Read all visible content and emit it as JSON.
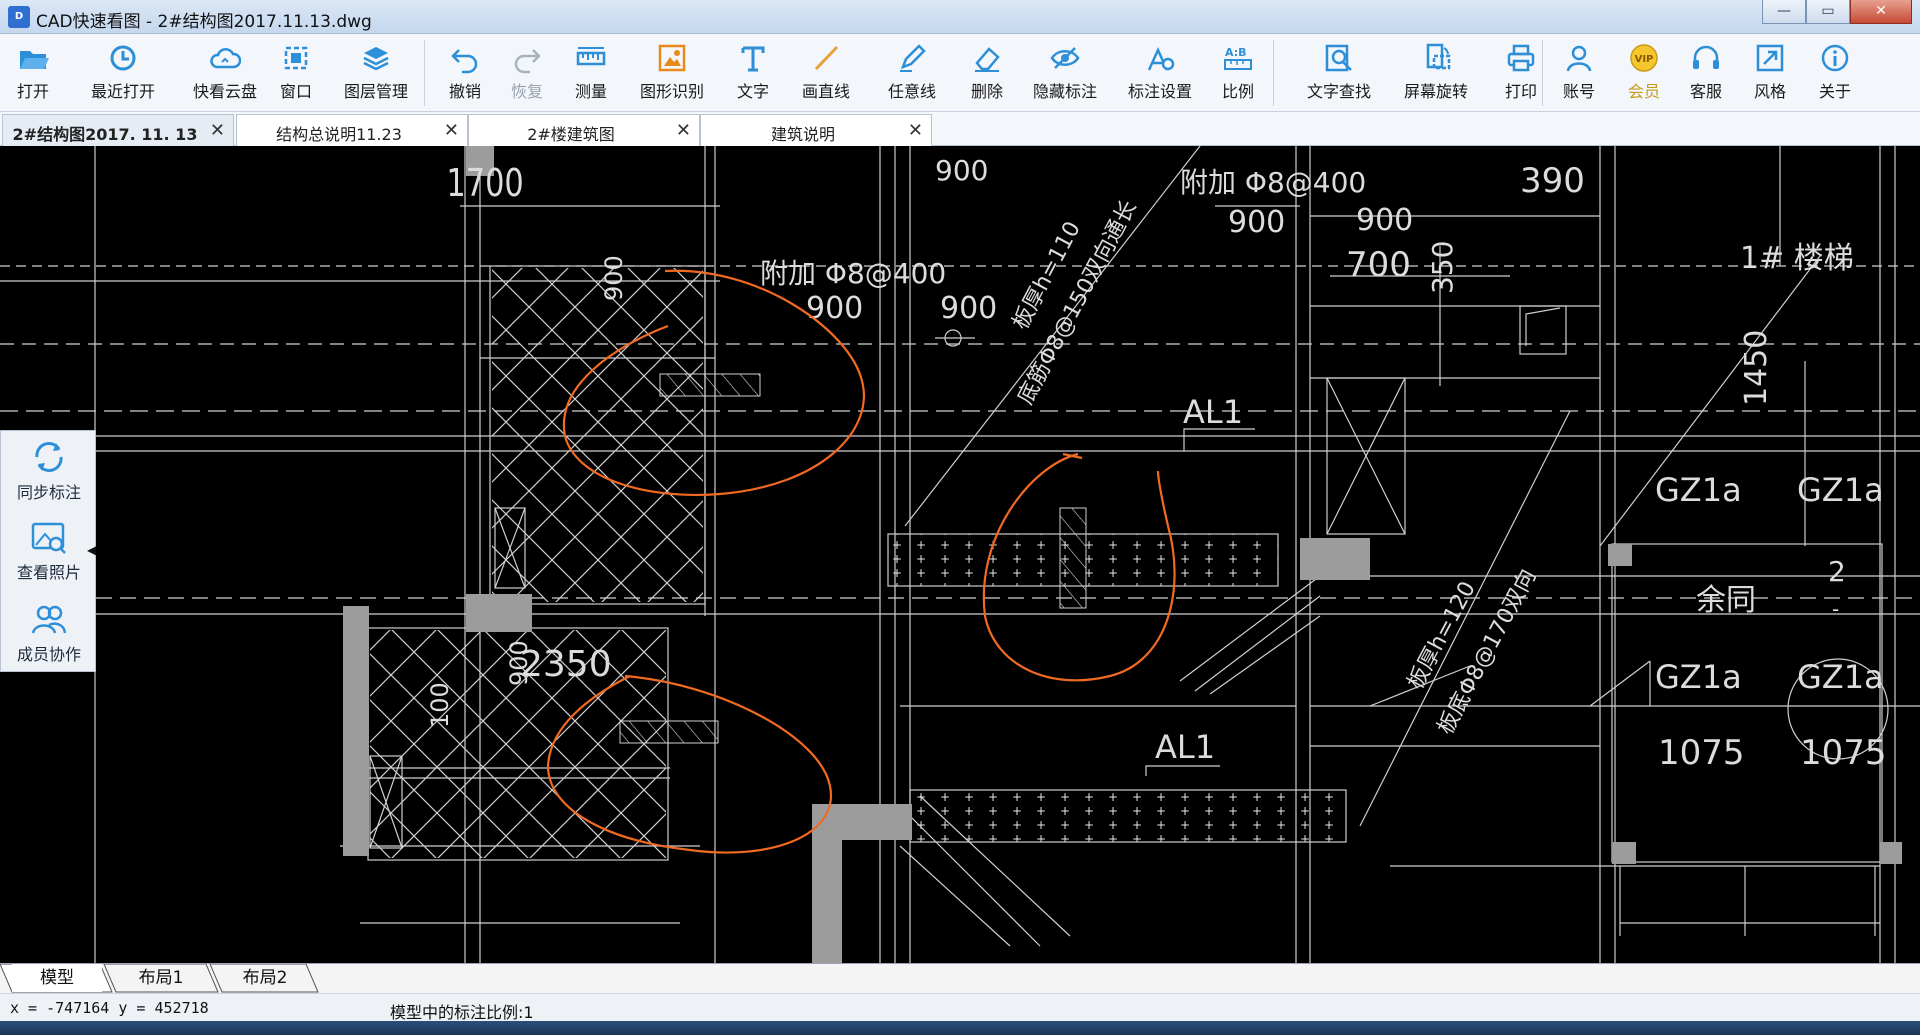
{
  "window": {
    "icon_text": "D",
    "title": "CAD快速看图 - 2#结构图2017.11.13.dwg",
    "title_faded": "",
    "controls": {
      "minimize": "—",
      "maximize": "▭",
      "close": "✕"
    }
  },
  "toolbar": {
    "items": [
      {
        "label": "打开",
        "icon": "folder-open-icon",
        "disabled": false
      },
      {
        "label": "最近打开",
        "icon": "recent-clock-icon",
        "disabled": false
      },
      {
        "label": "快看云盘",
        "icon": "cloud-icon",
        "disabled": false
      },
      {
        "label": "窗口",
        "icon": "window-icon",
        "disabled": false
      },
      {
        "label": "图层管理",
        "icon": "layers-icon",
        "disabled": false
      },
      {
        "label": "撤销",
        "icon": "undo-icon",
        "disabled": false
      },
      {
        "label": "恢复",
        "icon": "redo-icon",
        "disabled": true
      },
      {
        "label": "测量",
        "icon": "ruler-icon",
        "disabled": false
      },
      {
        "label": "图形识别",
        "icon": "shape-recognize-icon",
        "disabled": false
      },
      {
        "label": "文字",
        "icon": "text-icon",
        "disabled": false
      },
      {
        "label": "画直线",
        "icon": "line-icon",
        "disabled": false
      },
      {
        "label": "任意线",
        "icon": "pen-icon",
        "disabled": false
      },
      {
        "label": "删除",
        "icon": "eraser-icon",
        "disabled": false
      },
      {
        "label": "隐藏标注",
        "icon": "eye-hide-icon",
        "disabled": false
      },
      {
        "label": "标注设置",
        "icon": "annotation-settings-icon",
        "disabled": false
      },
      {
        "label": "比例",
        "icon": "scale-ratio-icon",
        "disabled": false
      },
      {
        "label": "文字查找",
        "icon": "text-search-icon",
        "disabled": false
      },
      {
        "label": "屏幕旋转",
        "icon": "rotate-screen-icon",
        "disabled": false
      },
      {
        "label": "打印",
        "icon": "printer-icon",
        "disabled": false
      },
      {
        "label": "账号",
        "icon": "user-icon",
        "disabled": false
      },
      {
        "label": "会员",
        "icon": "vip-icon",
        "disabled": false,
        "vip": true,
        "badge": "VIP"
      },
      {
        "label": "客服",
        "icon": "headset-icon",
        "disabled": false
      },
      {
        "label": "风格",
        "icon": "style-icon",
        "disabled": false
      },
      {
        "label": "关于",
        "icon": "info-icon",
        "disabled": false
      }
    ],
    "ratio_icon_text": "A:B"
  },
  "tabs": [
    {
      "label": "2#结构图2017. 11. 13",
      "active": true
    },
    {
      "label": "结构总说明11.23",
      "active": false
    },
    {
      "label": "2#楼建筑图",
      "active": false
    },
    {
      "label": "建筑说明",
      "active": false
    }
  ],
  "tab_close": "✕",
  "side_panel": {
    "items": [
      {
        "label": "同步标注",
        "icon": "sync-icon"
      },
      {
        "label": "查看照片",
        "icon": "photo-icon"
      },
      {
        "label": "成员协作",
        "icon": "members-icon"
      }
    ],
    "collapse": "◀"
  },
  "drawing": {
    "texts": {
      "d1700": "1700",
      "d900a": "900",
      "d900b": "900",
      "d900c": "900",
      "d900d": "900",
      "d900e": "900",
      "d900f": "900",
      "d900g": "900",
      "d900h": "900",
      "d390": "390",
      "d700": "700",
      "d350": "350",
      "d1450": "1450",
      "d2350": "2350",
      "d1075a": "1075",
      "d1075b": "1075",
      "d100": "100",
      "fujia1": "附加 Φ8@400",
      "fujia2": "附加 Φ8@400",
      "al1a": "AL1",
      "al1b": "AL1",
      "stair": "1# 楼梯",
      "gz1": "GZ1a",
      "gz2": "GZ1a",
      "gz3": "GZ1a",
      "gz4": "GZ1a",
      "circle_num": "2",
      "circle_dash": "-",
      "yutong": "余同",
      "slab1a": "板厚h=110",
      "slab1b": "底筋Φ8@150双向通长",
      "slab2a": "板厚h=120",
      "slab2b": "板底Φ8@170双向"
    }
  },
  "layout_tabs": [
    {
      "label": "模型",
      "active": true
    },
    {
      "label": "布局1",
      "active": false
    },
    {
      "label": "布局2",
      "active": false
    }
  ],
  "status": {
    "coords": "x = -747164  y = 452718",
    "scale": "模型中的标注比例:1"
  }
}
